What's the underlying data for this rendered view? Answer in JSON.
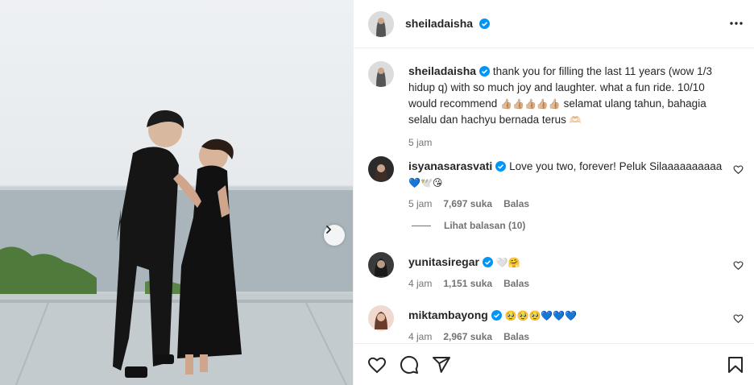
{
  "post": {
    "author": "sheiladaisha",
    "caption": {
      "username": "sheiladaisha",
      "text_line1": "thank you for filling the last 11 years (wow 1/3",
      "text_line2": "hidup q) with so much joy and laughter. what a fun ride. 10/10",
      "text_line3": "would recommend",
      "text_emoji1": "👍🏼👍🏼👍🏼👍🏼👍🏼",
      "text_line3b": "selamat ulang tahun, bahagia",
      "text_line4": "selalu dan hachyu bernada terus",
      "text_emoji2": "🫶🏻",
      "time": "5 jam"
    }
  },
  "comments": [
    {
      "username": "isyanasarasvati",
      "text": "Love you two, forever! Peluk Silaaaaaaaaaa",
      "emojis": "💙🕊️😘",
      "time": "5 jam",
      "likes": "7,697 suka",
      "reply": "Balas"
    },
    {
      "username": "yunitasiregar",
      "text": "",
      "emojis": "🤍🤗",
      "time": "4 jam",
      "likes": "1,151 suka",
      "reply": "Balas"
    },
    {
      "username": "miktambayong",
      "text": "",
      "emojis": "🥹🥹🥹💙💙💙",
      "time": "4 jam",
      "likes": "2,967 suka",
      "reply": "Balas"
    }
  ],
  "view_replies": "Lihat balasan (10)",
  "icons": {
    "more": "more-options-icon",
    "heart": "heart-icon",
    "comment": "comment-icon",
    "share": "share-icon",
    "bookmark": "bookmark-icon",
    "verified": "verified-badge-icon",
    "next": "chevron-right-icon"
  },
  "colors": {
    "verified": "#0095f6",
    "text": "#262626",
    "muted": "#737373"
  }
}
